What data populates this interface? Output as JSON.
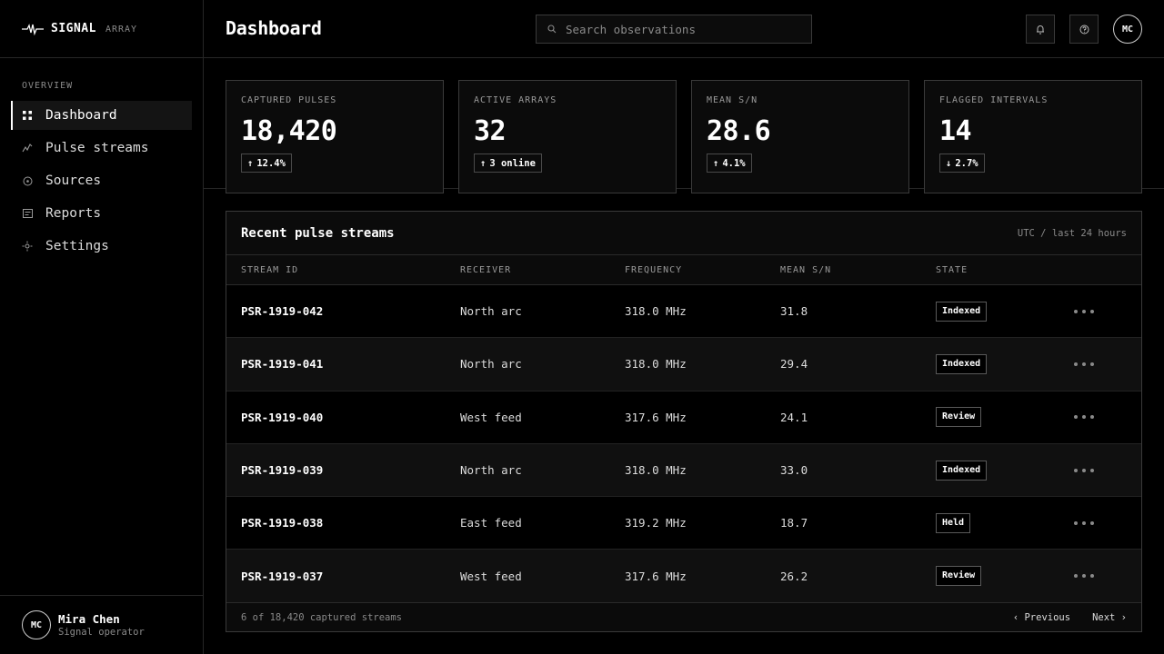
{
  "brand": {
    "name": "SIGNAL",
    "sub": "ARRAY"
  },
  "nav": {
    "section": "OVERVIEW",
    "items": [
      {
        "label": "Dashboard",
        "icon": "grid-icon",
        "active": true
      },
      {
        "label": "Pulse streams",
        "icon": "pulse-icon"
      },
      {
        "label": "Sources",
        "icon": "target-icon"
      },
      {
        "label": "Reports",
        "icon": "report-icon"
      },
      {
        "label": "Settings",
        "icon": "gear-icon"
      }
    ]
  },
  "user": {
    "initials": "MC",
    "name": "Mira Chen",
    "role": "Signal operator"
  },
  "header": {
    "title": "Dashboard",
    "search_placeholder": "Search observations",
    "avatar_initials": "MC"
  },
  "stats": [
    {
      "label": "CAPTURED PULSES",
      "value": "18,420",
      "delta": "12.4%",
      "direction": "up"
    },
    {
      "label": "ACTIVE ARRAYS",
      "value": "32",
      "delta": "3 online",
      "direction": "up"
    },
    {
      "label": "MEAN S/N",
      "value": "28.6",
      "delta": "4.1%",
      "direction": "up"
    },
    {
      "label": "FLAGGED INTERVALS",
      "value": "14",
      "delta": "2.7%",
      "direction": "down"
    }
  ],
  "table": {
    "title": "Recent pulse streams",
    "meta": "UTC / last 24 hours",
    "columns": [
      "STREAM ID",
      "RECEIVER",
      "FREQUENCY",
      "MEAN S/N",
      "STATE"
    ],
    "rows": [
      {
        "id": "PSR-1919-042",
        "receiver": "North arc",
        "frequency": "318.0 MHz",
        "sn": "31.8",
        "state": "Indexed"
      },
      {
        "id": "PSR-1919-041",
        "receiver": "North arc",
        "frequency": "318.0 MHz",
        "sn": "29.4",
        "state": "Indexed"
      },
      {
        "id": "PSR-1919-040",
        "receiver": "West feed",
        "frequency": "317.6 MHz",
        "sn": "24.1",
        "state": "Review"
      },
      {
        "id": "PSR-1919-039",
        "receiver": "North arc",
        "frequency": "318.0 MHz",
        "sn": "33.0",
        "state": "Indexed"
      },
      {
        "id": "PSR-1919-038",
        "receiver": "East feed",
        "frequency": "319.2 MHz",
        "sn": "18.7",
        "state": "Held"
      },
      {
        "id": "PSR-1919-037",
        "receiver": "West feed",
        "frequency": "317.6 MHz",
        "sn": "26.2",
        "state": "Review"
      }
    ],
    "footer_count": "6 of 18,420 captured streams",
    "prev_label": "‹ Previous",
    "next_label": "Next ›"
  }
}
